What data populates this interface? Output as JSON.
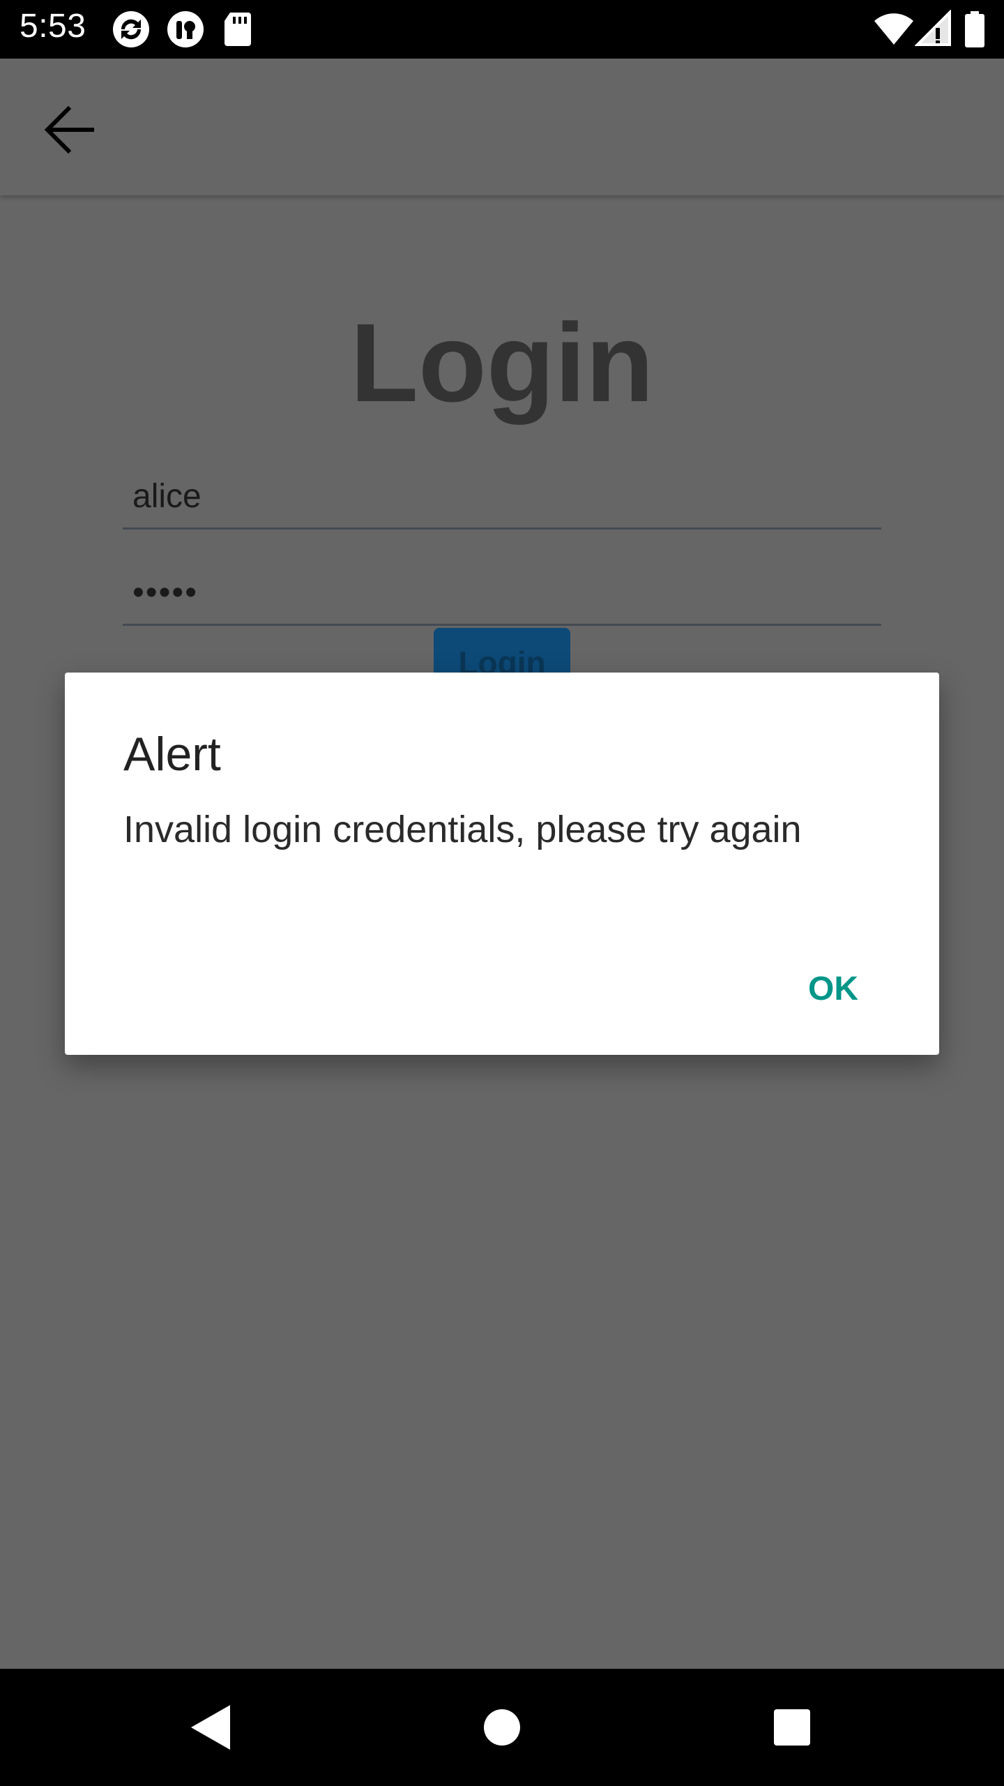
{
  "status_bar": {
    "time": "5:53",
    "icons": [
      "sync-icon",
      "notification-app-icon",
      "sd-card-icon",
      "wifi-icon",
      "cell-signal-icon",
      "battery-icon"
    ]
  },
  "app_bar": {
    "back_icon": "arrow-back-icon"
  },
  "login_screen": {
    "title": "Login",
    "username_value": "alice",
    "password_value": "•••••",
    "login_button_label": "Login"
  },
  "dialog": {
    "title": "Alert",
    "message": "Invalid login credentials, please try again",
    "ok_label": "OK"
  },
  "nav_bar": {
    "icons": [
      "back-triangle-icon",
      "home-circle-icon",
      "recents-square-icon"
    ]
  },
  "colors": {
    "scrim": "#666666",
    "accent": "#009688",
    "button": "#0d4a78"
  }
}
